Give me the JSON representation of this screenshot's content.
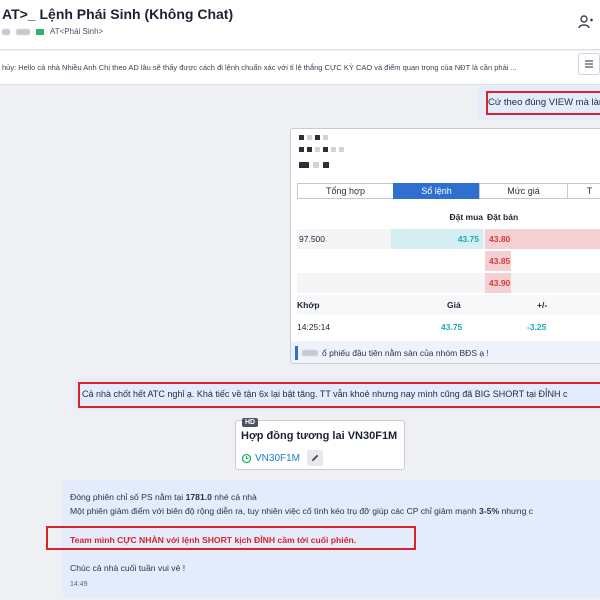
{
  "header": {
    "title": "AT>_ Lệnh Phái Sinh (Không Chat)",
    "tag_label": "AT<Phái Sinh>"
  },
  "pinned": {
    "text": "hủy: Hello cả nhà Nhiều Anh Chị theo AD lâu sẽ thấy được cách đi lệnh chuẩn xác với tỉ lệ thắng CỰC KỲ CAO và điểm quan trọng của NĐT là cần phải ..."
  },
  "reply_msg": {
    "text": "Cứ theo đúng VIEW mà làm"
  },
  "order_card": {
    "tabs": [
      "Tổng hợp",
      "Sổ lệnh",
      "Mức giá",
      "T"
    ],
    "active_tab": "Sổ lệnh",
    "col_buy": "Đặt mua",
    "col_sell": "Đặt bán",
    "book": [
      {
        "vol": "97.500",
        "buy": "43.75",
        "sell": "43.80"
      },
      {
        "vol": "",
        "buy": "",
        "sell": "43.85"
      },
      {
        "vol": "",
        "buy": "",
        "sell": "43.90"
      }
    ],
    "match_header": {
      "label": "Khớp",
      "price": "Giá",
      "change": "+/-"
    },
    "match_row": {
      "time": "14:25:14",
      "price": "43.75",
      "change": "-3.25"
    },
    "footer": "ổ phiếu đầu tiên nằm sàn của nhóm BĐS ạ !"
  },
  "message2": {
    "text": "Cả nhà chốt hết ATC nghỉ ạ. Khá tiếc về tận 6x lại bật tăng. TT vẫn khoẻ nhưng nay mình cũng đã BIG SHORT tại ĐỈNH c"
  },
  "contract": {
    "badge": "HD",
    "title": "Hợp đồng tương lai VN30F1M",
    "link": "VN30F1M"
  },
  "message3": {
    "line1_a": "Đóng phiên chỉ số PS nằm tại ",
    "line1_b": "1781.0",
    "line1_c": " nhé cả nhà",
    "line2_a": "Một phiên giảm điểm với biên độ rộng diễn ra, tuy nhiên việc cố tình kéo trụ đỡ giúp các CP chỉ giảm mạnh ",
    "line2_b": "3-5%",
    "line2_c": " nhưng c",
    "highlight": "Team mình CỰC NHÀN với lệnh SHORT kịch ĐỈNH cầm tới cuối phiên.",
    "closing": "Chúc cả nhà cuối tuần vui vẻ !",
    "time": "14:49"
  },
  "colors": {
    "accent": "#2f6fd0",
    "highlight_border": "#d8232a",
    "buy_bg": "#d4eef2",
    "sell_bg": "#f5d0d2"
  }
}
